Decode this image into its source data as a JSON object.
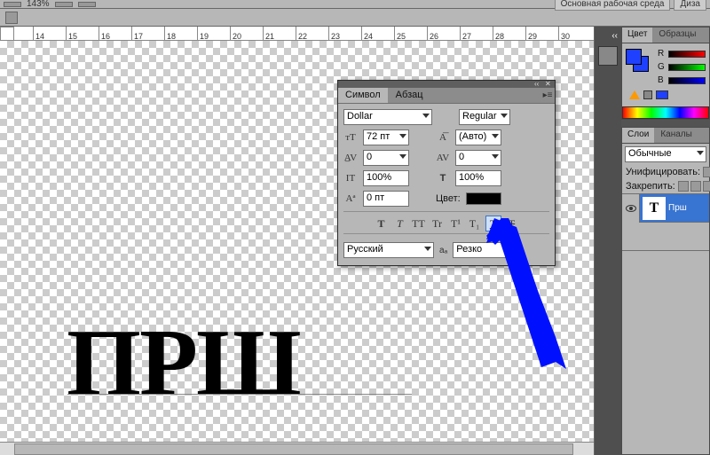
{
  "top_toolbar": {
    "zoom": "143%",
    "workspace_button": "Основная рабочая среда",
    "design_button": "Диза"
  },
  "ruler_ticks": [
    "",
    "14",
    "15",
    "16",
    "17",
    "18",
    "19",
    "20",
    "21",
    "22",
    "23",
    "24",
    "25",
    "26",
    "27",
    "28",
    "29",
    "30"
  ],
  "canvas_text": "ПРШ",
  "color_panel": {
    "tab_color": "Цвет",
    "tab_swatches": "Образцы",
    "r": "R",
    "g": "G",
    "b": "B"
  },
  "layers_panel": {
    "tab_layers": "Слои",
    "tab_channels": "Каналы",
    "blend_mode": "Обычные",
    "unify": "Унифицировать:",
    "lock": "Закрепить:",
    "layer_thumb": "T",
    "layer_name": "Прш"
  },
  "char_panel": {
    "tab_symbol": "Символ",
    "tab_paragraph": "Абзац",
    "font": "Dollar",
    "font_style": "Regular",
    "size": "72 пт",
    "leading": "(Авто)",
    "kerning": "0",
    "tracking": "0",
    "v_scale": "100%",
    "h_scale": "100%",
    "baseline": "0 пт",
    "color_label": "Цвет:",
    "tt": {
      "b1": "T",
      "b2": "T",
      "b3": "TT",
      "b4": "Tr",
      "b5": "T¹",
      "b6": "T₁",
      "b7": "T",
      "b8": "Ŧ"
    },
    "language": "Русский",
    "antialias": "Резко"
  }
}
